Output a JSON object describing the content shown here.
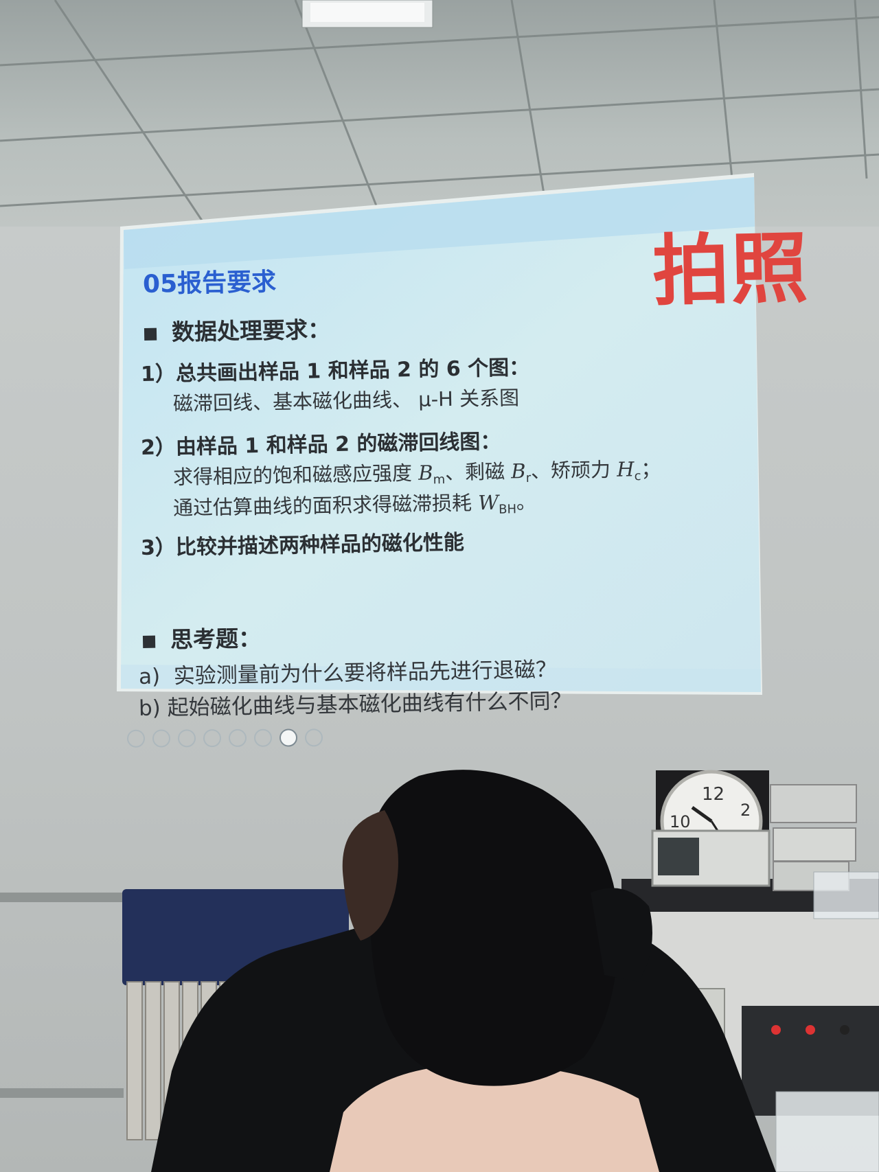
{
  "slide": {
    "title": "05报告要求",
    "stamp": "拍照",
    "section1": {
      "heading": "数据处理要求："
    },
    "item1": {
      "num": "1）",
      "text": "总共画出样品 1 和样品 2 的 6 个图：",
      "detail": "磁滞回线、基本磁化曲线、 μ-H 关系图"
    },
    "item2": {
      "num": "2）",
      "text": "由样品 1 和样品 2 的磁滞回线图：",
      "line1_a": "求得相应的饱和磁感应强度 ",
      "bm": "B",
      "bm_sub": "m",
      "line1_b": "、剩磁 ",
      "br": "B",
      "br_sub": "r",
      "line1_c": "、矫顽力 ",
      "hc": "H",
      "hc_sub": "c",
      "line1_d": "；",
      "line2_a": "通过估算曲线的面积求得磁滞损耗 ",
      "wbh": "W",
      "wbh_sub": "BH",
      "line2_b": "。"
    },
    "item3": {
      "num": "3）",
      "text": "比较并描述两种样品的磁化性能"
    },
    "section2": {
      "heading": "思考题："
    },
    "q_a": {
      "label": "a)",
      "text": "实验测量前为什么要将样品先进行退磁？"
    },
    "q_b": {
      "label": "b)",
      "text": "起始磁化曲线与基本磁化曲线有什么不同？"
    }
  },
  "clock": {
    "num_12": "12",
    "num_10": "10",
    "num_2": "2"
  },
  "colors": {
    "title_blue": "#2a5fd0",
    "stamp_red": "#e0453f",
    "slide_bg": "#cfe6ee",
    "hair": "#0e0e10"
  },
  "icons": [
    "prev-icon",
    "next-icon",
    "pen-icon",
    "grid-icon",
    "zoom-icon",
    "screen-icon",
    "camera-icon",
    "more-icon"
  ]
}
